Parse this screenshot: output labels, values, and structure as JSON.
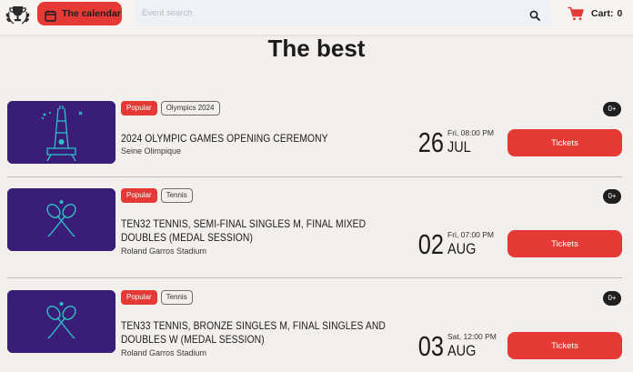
{
  "header": {
    "logo_icon": "trophy-laurel-logo-icon",
    "calendar_button": {
      "label": "The calendar",
      "icon": "calendar-icon"
    },
    "search": {
      "placeholder": "Event search",
      "value": "",
      "icon": "search-icon"
    },
    "cart": {
      "icon": "cart-icon",
      "label": "Cart:",
      "count": "0"
    }
  },
  "section_title": "The best",
  "colors": {
    "accent": "#e53935",
    "thumb_bg": "#3a1d78",
    "thumb_art": "#2ec4c4",
    "background": "#f3efec"
  },
  "events": [
    {
      "tags": [
        "Popular",
        "Olympics 2024"
      ],
      "name": "2024 OLYMPIC GAMES OPENING CEREMONY",
      "venue": "Seine Olimpique",
      "day": "26",
      "weekday_time": "Fri, 08:00 PM",
      "month": "JUL",
      "button": "Tickets",
      "age": "0+",
      "thumb_icon": "eiffel-tower-icon"
    },
    {
      "tags": [
        "Popular",
        "Tennis"
      ],
      "name": "TEN32 TENNIS, SEMI-FINAL SINGLES M, FINAL MIXED DOUBLES (MEDAL SESSION)",
      "venue": "Roland Garros Stadium",
      "day": "02",
      "weekday_time": "Fri, 07:00 PM",
      "month": "AUG",
      "button": "Tickets",
      "age": "0+",
      "thumb_icon": "tennis-rackets-icon"
    },
    {
      "tags": [
        "Popular",
        "Tennis"
      ],
      "name": "TEN33 TENNIS, BRONZE SINGLES M, FINAL SINGLES AND DOUBLES W (MEDAL SESSION)",
      "venue": "Roland Garros Stadium",
      "day": "03",
      "weekday_time": "Sat, 12:00 PM",
      "month": "AUG",
      "button": "Tickets",
      "age": "0+",
      "thumb_icon": "tennis-rackets-icon"
    }
  ]
}
